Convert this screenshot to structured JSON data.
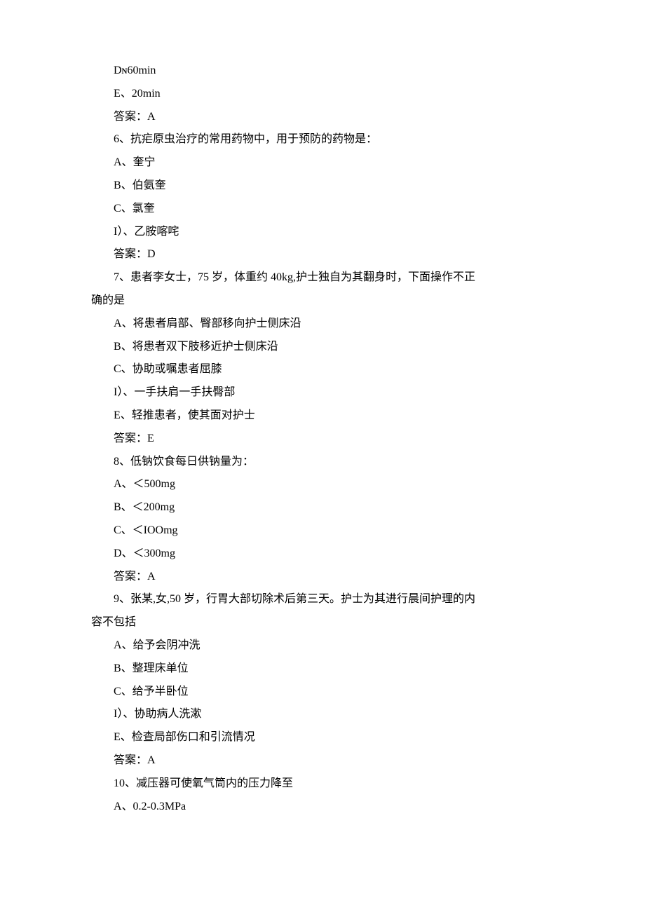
{
  "lines": [
    {
      "cls": "indent1",
      "text": "Dɴ60min"
    },
    {
      "cls": "indent1",
      "text": ""
    },
    {
      "cls": "indent1",
      "text": "E、20min"
    },
    {
      "cls": "indent1",
      "text": "答案：A"
    },
    {
      "cls": "indent1",
      "text": "6、抗疟原虫治疗的常用药物中，用于预防的药物是："
    },
    {
      "cls": "indent1",
      "text": "A、奎宁"
    },
    {
      "cls": "indent1",
      "text": "B、伯氨奎"
    },
    {
      "cls": "indent1",
      "text": "C、氯奎"
    },
    {
      "cls": "indent1",
      "text": "I）、乙胺喀咤"
    },
    {
      "cls": "indent1",
      "text": "答案：D"
    },
    {
      "cls": "indent1",
      "text": "7、患者李女士，75 岁，体重约 40kg,护士独自为其翻身时，下面操作不正"
    },
    {
      "cls": "no-indent",
      "text": "确的是"
    },
    {
      "cls": "indent1",
      "text": "A、将患者肩部、臀部移向护士侧床沿"
    },
    {
      "cls": "indent1",
      "text": "B、将患者双下肢移近护士侧床沿"
    },
    {
      "cls": "indent1",
      "text": "C、协助或嘱患者屈膝"
    },
    {
      "cls": "indent1",
      "text": "I）、一手扶肩一手扶臀部"
    },
    {
      "cls": "indent1",
      "text": "E、轻推患者，使其面对护士"
    },
    {
      "cls": "indent1",
      "text": "答案：E"
    },
    {
      "cls": "indent1",
      "text": "8、低钠饮食每日供钠量为："
    },
    {
      "cls": "indent1",
      "text": "A、＜500mg"
    },
    {
      "cls": "indent1",
      "text": "B、＜200mg"
    },
    {
      "cls": "indent1",
      "text": "C、＜IOOmg"
    },
    {
      "cls": "indent1",
      "text": "D、＜300mg"
    },
    {
      "cls": "indent1",
      "text": "答案：A"
    },
    {
      "cls": "indent1",
      "text": "9、张某,女,50 岁，行胃大部切除术后第三天。护士为其进行晨间护理的内"
    },
    {
      "cls": "no-indent",
      "text": "容不包括"
    },
    {
      "cls": "indent1",
      "text": "A、给予会阴冲洗"
    },
    {
      "cls": "indent1",
      "text": "B、整理床单位"
    },
    {
      "cls": "indent1",
      "text": "C、给予半卧位"
    },
    {
      "cls": "indent1",
      "text": "I）、协助病人洗漱"
    },
    {
      "cls": "indent1",
      "text": "E、检查局部伤口和引流情况"
    },
    {
      "cls": "indent1",
      "text": "答案：A"
    },
    {
      "cls": "indent1",
      "text": "10、减压器可使氧气筒内的压力降至"
    },
    {
      "cls": "indent1",
      "text": "A、0.2-0.3MPa"
    }
  ]
}
